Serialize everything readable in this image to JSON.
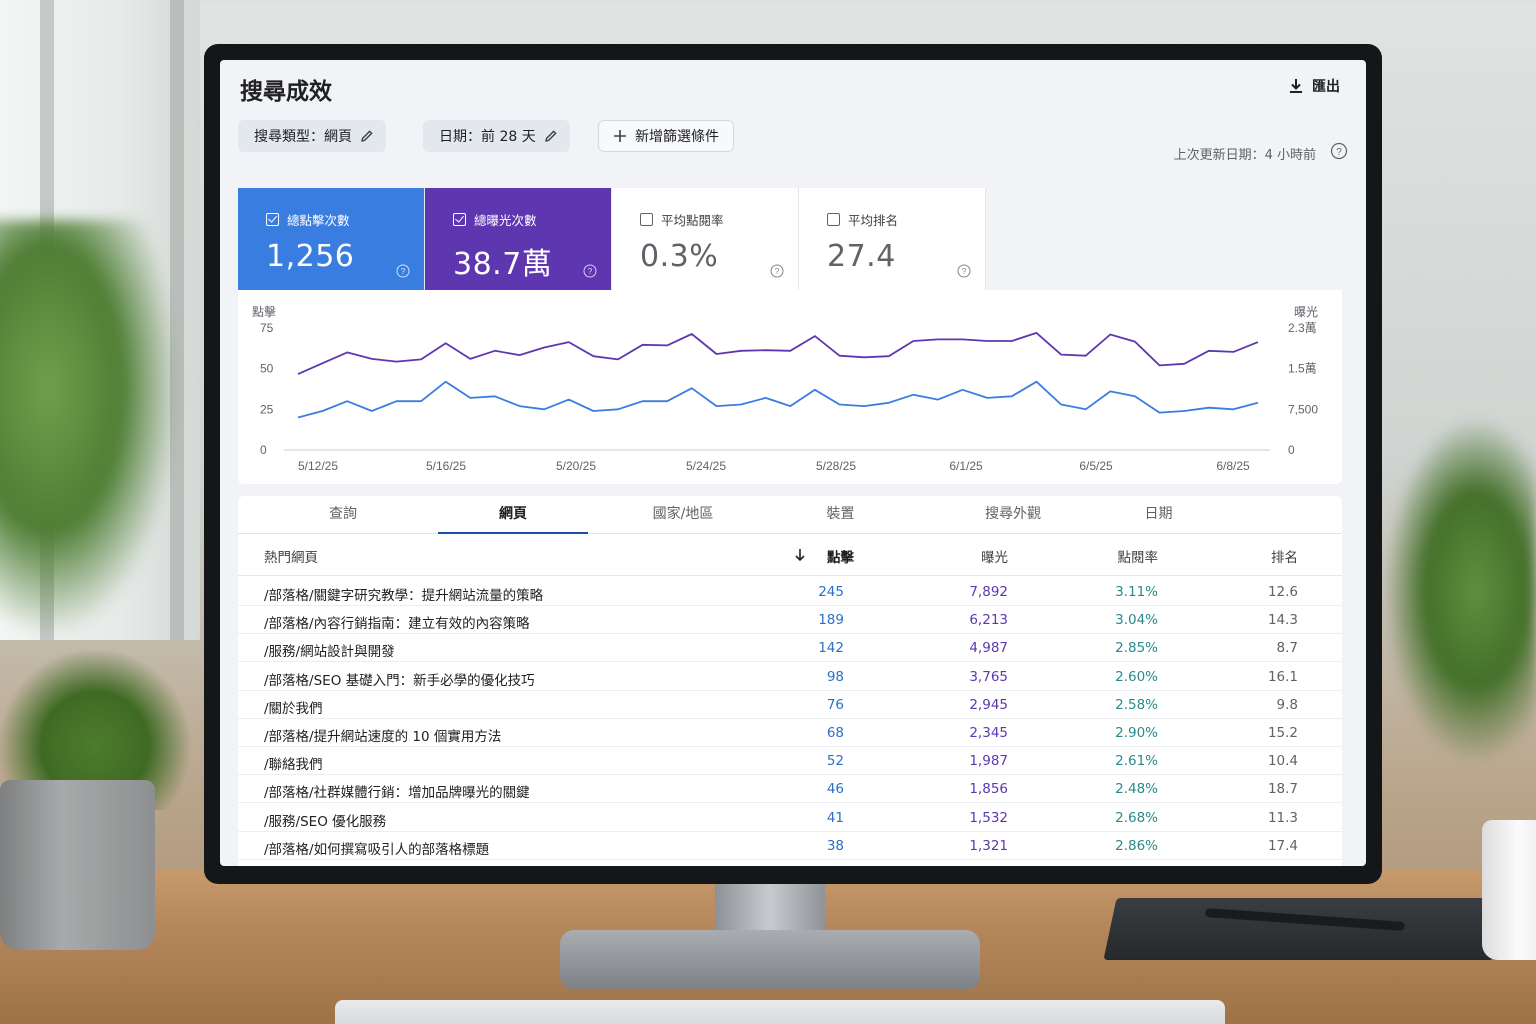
{
  "header": {
    "title": "搜尋成效",
    "export_label": "匯出"
  },
  "filters": {
    "search_type": "搜尋類型：網頁",
    "date": "日期：前 28 天",
    "add_filter": "新增篩選條件",
    "last_update": "上次更新日期：4 小時前"
  },
  "metrics": [
    {
      "label": "總點擊次數",
      "value": "1,256",
      "checked": true,
      "color": "#3a7de0"
    },
    {
      "label": "總曝光次數",
      "value": "38.7萬",
      "checked": true,
      "color": "#5e37b0"
    },
    {
      "label": "平均點閱率",
      "value": "0.3%",
      "checked": false
    },
    {
      "label": "平均排名",
      "value": "27.4",
      "checked": false
    }
  ],
  "chart_data": {
    "type": "line",
    "left_axis_label": "點擊",
    "right_axis_label": "曝光",
    "left_ticks": [
      "75",
      "50",
      "25",
      "0"
    ],
    "right_ticks": [
      "2.3萬",
      "1.5萬",
      "7,500",
      "0"
    ],
    "ylim_left": [
      0,
      75
    ],
    "ylim_right": [
      0,
      22500
    ],
    "x_tick_labels": [
      "5/12/25",
      "5/16/25",
      "5/20/25",
      "5/24/25",
      "5/28/25",
      "6/1/25",
      "6/5/25",
      "6/8/25"
    ],
    "series": [
      {
        "name": "總曝光次數",
        "color": "#5e37b0",
        "values": [
          14000,
          16000,
          18000,
          16800,
          16300,
          16700,
          19700,
          16800,
          18300,
          17500,
          18900,
          19900,
          17300,
          16700,
          19400,
          19300,
          21400,
          17700,
          18300,
          18400,
          18300,
          21000,
          17400,
          17100,
          17300,
          20100,
          20400,
          20400,
          20100,
          20100,
          21600,
          17600,
          17400,
          21300,
          20000,
          15600,
          15900,
          18300,
          18100,
          19900
        ]
      },
      {
        "name": "總點擊次數",
        "color": "#3a7de0",
        "values": [
          20,
          24,
          30,
          24,
          30,
          30,
          42,
          32,
          33,
          27,
          25,
          31,
          24,
          25,
          30,
          30,
          38,
          27,
          28,
          32,
          27,
          37,
          28,
          27,
          29,
          34,
          31,
          37,
          32,
          33,
          42,
          28,
          25,
          36,
          33,
          23,
          24,
          26,
          25,
          29
        ]
      }
    ]
  },
  "tabs": [
    "查詢",
    "網頁",
    "國家/地區",
    "裝置",
    "搜尋外觀",
    "日期"
  ],
  "active_tab": 1,
  "table": {
    "columns": [
      "熱門網頁",
      "點擊",
      "曝光",
      "點閱率",
      "排名"
    ],
    "rows": [
      {
        "page": "/部落格/關鍵字研究教學：提升網站流量的策略",
        "clicks": "245",
        "impressions": "7,892",
        "ctr": "3.11%",
        "position": "12.6"
      },
      {
        "page": "/部落格/內容行銷指南：建立有效的內容策略",
        "clicks": "189",
        "impressions": "6,213",
        "ctr": "3.04%",
        "position": "14.3"
      },
      {
        "page": "/服務/網站設計與開發",
        "clicks": "142",
        "impressions": "4,987",
        "ctr": "2.85%",
        "position": "8.7"
      },
      {
        "page": "/部落格/SEO 基礎入門：新手必學的優化技巧",
        "clicks": "98",
        "impressions": "3,765",
        "ctr": "2.60%",
        "position": "16.1"
      },
      {
        "page": "/關於我們",
        "clicks": "76",
        "impressions": "2,945",
        "ctr": "2.58%",
        "position": "9.8"
      },
      {
        "page": "/部落格/提升網站速度的 10 個實用方法",
        "clicks": "68",
        "impressions": "2,345",
        "ctr": "2.90%",
        "position": "15.2"
      },
      {
        "page": "/聯絡我們",
        "clicks": "52",
        "impressions": "1,987",
        "ctr": "2.61%",
        "position": "10.4"
      },
      {
        "page": "/部落格/社群媒體行銷：增加品牌曝光的關鍵",
        "clicks": "46",
        "impressions": "1,856",
        "ctr": "2.48%",
        "position": "18.7"
      },
      {
        "page": "/服務/SEO 優化服務",
        "clicks": "41",
        "impressions": "1,532",
        "ctr": "2.68%",
        "position": "11.3"
      },
      {
        "page": "/部落格/如何撰寫吸引人的部落格標題",
        "clicks": "38",
        "impressions": "1,321",
        "ctr": "2.86%",
        "position": "17.4"
      }
    ]
  },
  "icons": {
    "export": "download-icon",
    "edit": "pencil-icon",
    "add": "plus-icon",
    "help": "help-circle-icon",
    "sort": "arrow-down-icon"
  }
}
